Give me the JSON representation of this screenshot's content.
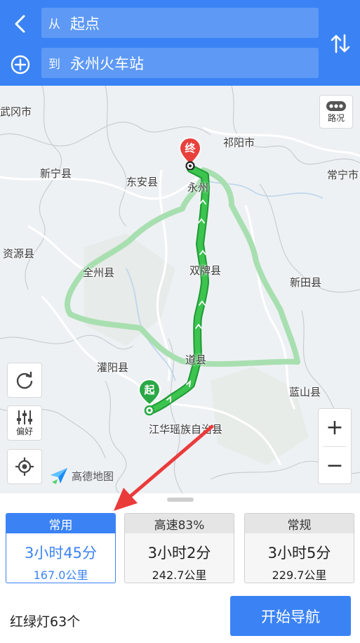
{
  "header": {
    "from_prefix": "从",
    "from_value": "起点",
    "to_prefix": "到",
    "to_value": "永州火车站"
  },
  "map": {
    "labels": {
      "wugang": "武冈市",
      "qiyang": "祁阳市",
      "xinning": "新宁县",
      "dongan": "东安县",
      "yongzhou": "永州",
      "changning": "常宁市",
      "ziyuan": "资源县",
      "quanzhou": "全州县",
      "shuangpai": "双牌县",
      "xintian": "新田县",
      "guanyang": "灌阳县",
      "daoxian": "道县",
      "lanshan": "蓝山县",
      "jianghua": "江华瑶族自治县"
    },
    "end_marker": "终",
    "start_marker": "起",
    "traffic_button": "路况",
    "preference_button": "偏好",
    "zoom_in": "+",
    "zoom_out": "−",
    "logo_text": "高德地图"
  },
  "routes": [
    {
      "tab": "常用",
      "duration": "3小时45分",
      "distance": "167.0公里",
      "active": true
    },
    {
      "tab": "高速83%",
      "duration": "3小时2分",
      "distance": "242.7公里",
      "active": false
    },
    {
      "tab": "常规",
      "duration": "3小时5分",
      "distance": "229.7公里",
      "active": false
    }
  ],
  "footer": {
    "traffic_lights": "红绿灯63个",
    "start_button": "开始导航"
  },
  "colors": {
    "primary": "#3b83f5",
    "route_green": "#22a83a",
    "alt_route": "#a8dfb0",
    "end_marker": "#e8413c",
    "arrow_red": "#ea3b3b"
  }
}
